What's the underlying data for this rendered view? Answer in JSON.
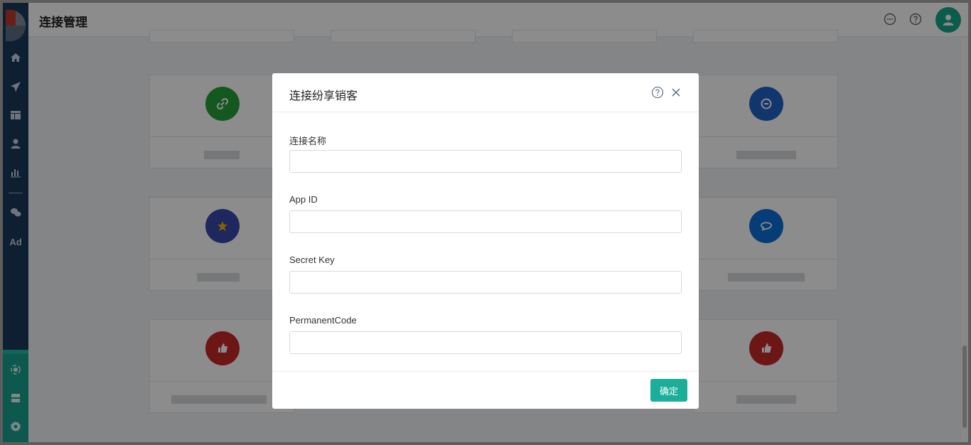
{
  "header": {
    "title": "连接管理",
    "icons": [
      "chat-icon",
      "help-icon"
    ],
    "avatar_icon": "user-icon"
  },
  "sidebar": {
    "items": [
      {
        "icon": "home-icon"
      },
      {
        "icon": "send-icon"
      },
      {
        "icon": "layout-icon"
      },
      {
        "icon": "user-icon"
      },
      {
        "icon": "bar-chart-icon"
      },
      {
        "icon": "wechat-icon"
      },
      {
        "label": "Ad"
      }
    ],
    "bottom_items": [
      {
        "icon": "connect-hub-icon"
      },
      {
        "icon": "server-icon"
      },
      {
        "icon": "gear-icon"
      }
    ]
  },
  "cards": [
    {
      "icon": "link-icon",
      "color": "#27a13a"
    },
    {
      "icon": "chat-face-icon",
      "color": "#1f63c8"
    },
    {
      "icon": "star-icon",
      "color": "#3949ab"
    },
    {
      "icon": "chat-bubble-icon",
      "color": "#0b6fd8"
    },
    {
      "icon": "thumbs-up-icon",
      "color": "#c62828"
    },
    {
      "icon": "thumbs-up-icon",
      "color": "#c62828"
    }
  ],
  "modal": {
    "title": "连接纷享销客",
    "help_icon": "help-icon",
    "close_icon": "close-icon",
    "fields": [
      {
        "label": "连接名称",
        "value": ""
      },
      {
        "label": "App ID",
        "value": ""
      },
      {
        "label": "Secret Key",
        "value": ""
      },
      {
        "label": "PermanentCode",
        "value": ""
      }
    ],
    "confirm_label": "确定"
  },
  "colors": {
    "accent": "#1aae9b",
    "sidebar": "#1c3a5c"
  }
}
